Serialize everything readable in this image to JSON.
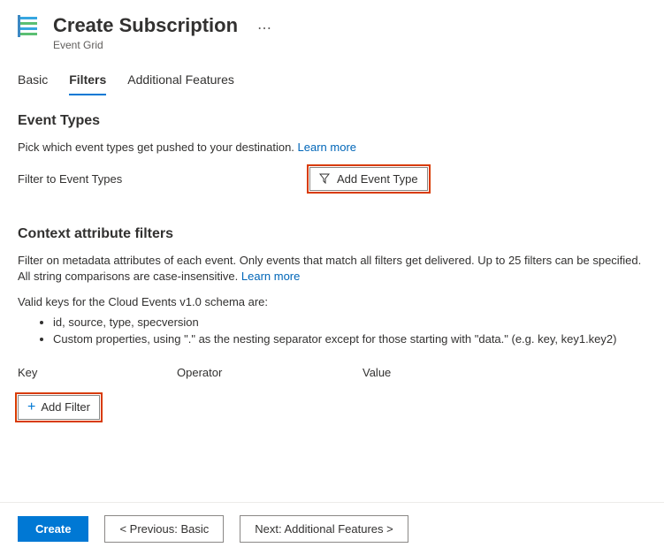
{
  "header": {
    "title": "Create Subscription",
    "subtitle": "Event Grid"
  },
  "tabs": {
    "basic": "Basic",
    "filters": "Filters",
    "additional": "Additional Features"
  },
  "eventTypes": {
    "title": "Event Types",
    "desc": "Pick which event types get pushed to your destination. ",
    "learnMore": "Learn more",
    "filterLabel": "Filter to Event Types",
    "addBtn": "Add Event Type"
  },
  "contextFilters": {
    "title": "Context attribute filters",
    "desc": "Filter on metadata attributes of each event. Only events that match all filters get delivered. Up to 25 filters can be specified. All string comparisons are case-insensitive. ",
    "learnMore": "Learn more",
    "validKeysIntro": "Valid keys for the Cloud Events v1.0 schema are:",
    "key1": "id, source, type, specversion",
    "key2": "Custom properties, using \".\" as the nesting separator except for those starting with \"data.\" (e.g. key, key1.key2)",
    "colKey": "Key",
    "colOperator": "Operator",
    "colValue": "Value",
    "addFilterBtn": "Add Filter"
  },
  "footer": {
    "create": "Create",
    "prev": "< Previous: Basic",
    "next": "Next: Additional Features >"
  }
}
